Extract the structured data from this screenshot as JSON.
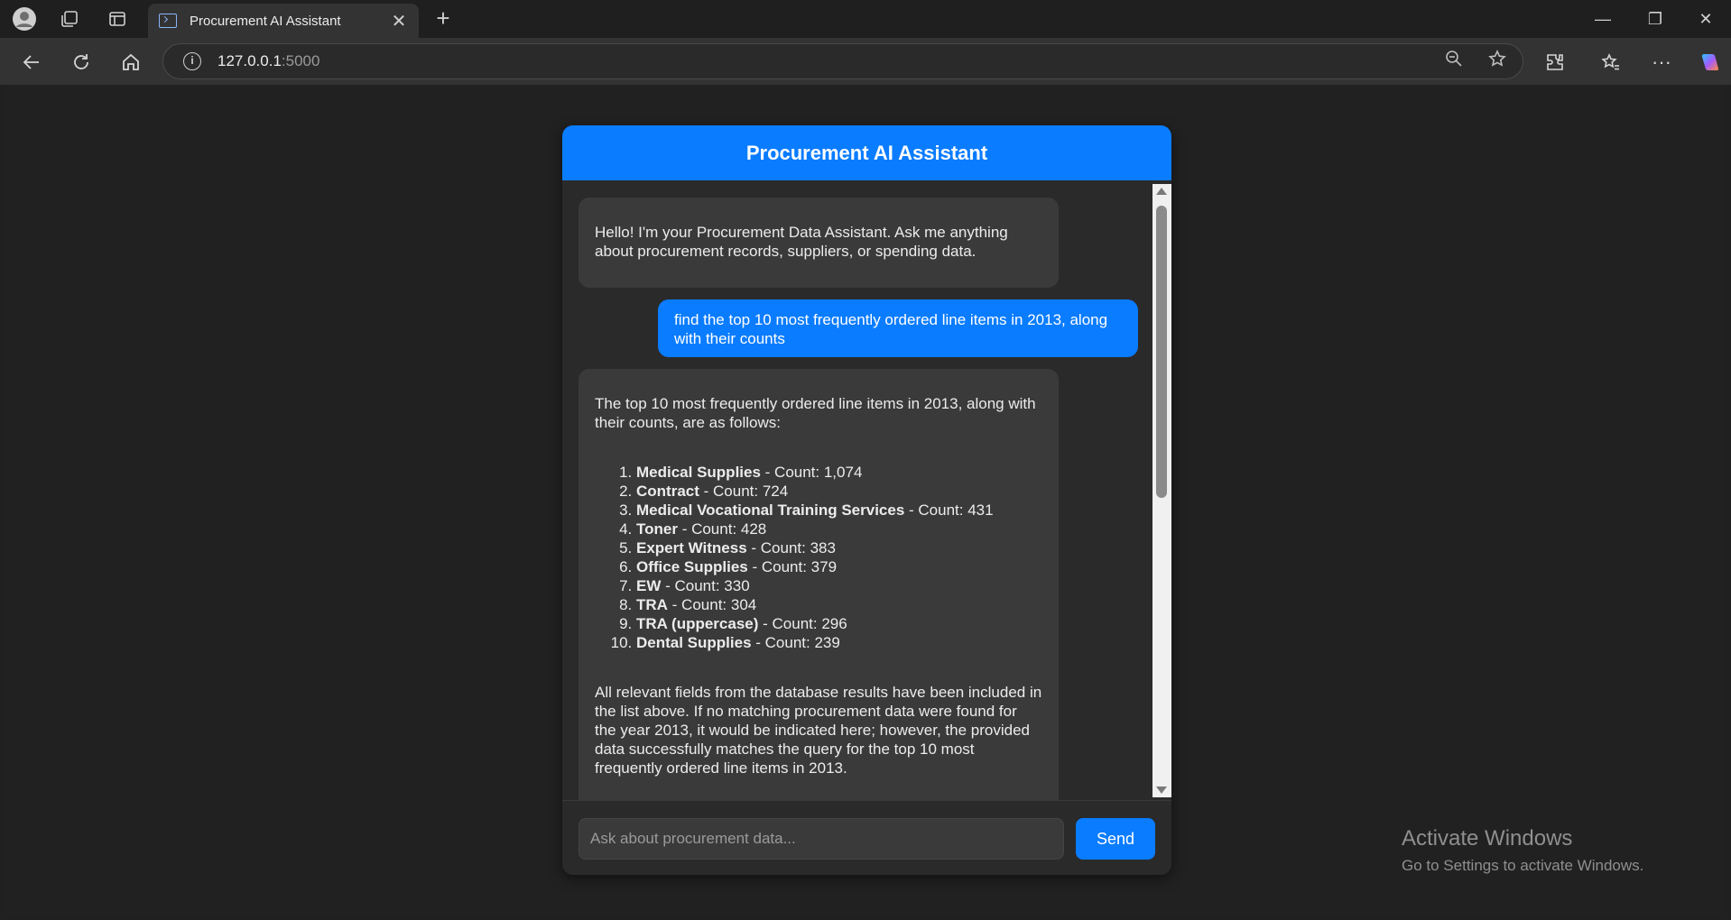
{
  "browser": {
    "tab_title": "Procurement AI Assistant",
    "url_host": "127.0.0.1",
    "url_port": ":5000"
  },
  "chat": {
    "title": "Procurement AI Assistant",
    "greeting": "Hello! I'm your Procurement Data Assistant. Ask me anything about procurement records, suppliers, or spending data.",
    "user_query": "find the top 10 most frequently ordered line items in 2013, along with their counts",
    "answer_intro": "The top 10 most frequently ordered line items in 2013, along with their counts, are as follows:",
    "items": [
      {
        "name": "Medical Supplies",
        "count": " - Count: 1,074"
      },
      {
        "name": "Contract",
        "count": " - Count: 724"
      },
      {
        "name": "Medical Vocational Training Services",
        "count": " - Count: 431"
      },
      {
        "name": "Toner",
        "count": " - Count: 428"
      },
      {
        "name": "Expert Witness",
        "count": " - Count: 383"
      },
      {
        "name": "Office Supplies",
        "count": " - Count: 379"
      },
      {
        "name": "EW",
        "count": " - Count: 330"
      },
      {
        "name": "TRA",
        "count": " - Count: 304"
      },
      {
        "name": "TRA (uppercase)",
        "count": " - Count: 296"
      },
      {
        "name": "Dental Supplies",
        "count": " - Count: 239"
      }
    ],
    "answer_outro": "All relevant fields from the database results have been included in the list above. If no matching procurement data were found for the year 2013, it would be indicated here; however, the provided data successfully matches the query for the top 10 most frequently ordered line items in 2013.",
    "input_placeholder": "Ask about procurement data...",
    "send_label": "Send"
  },
  "watermark": {
    "line1": "Activate Windows",
    "line2": "Go to Settings to activate Windows."
  },
  "colors": {
    "accent": "#0a7cff",
    "bubble_bot": "#3a3a3a",
    "panel": "#2a2a2a",
    "page_bg": "#212121"
  }
}
